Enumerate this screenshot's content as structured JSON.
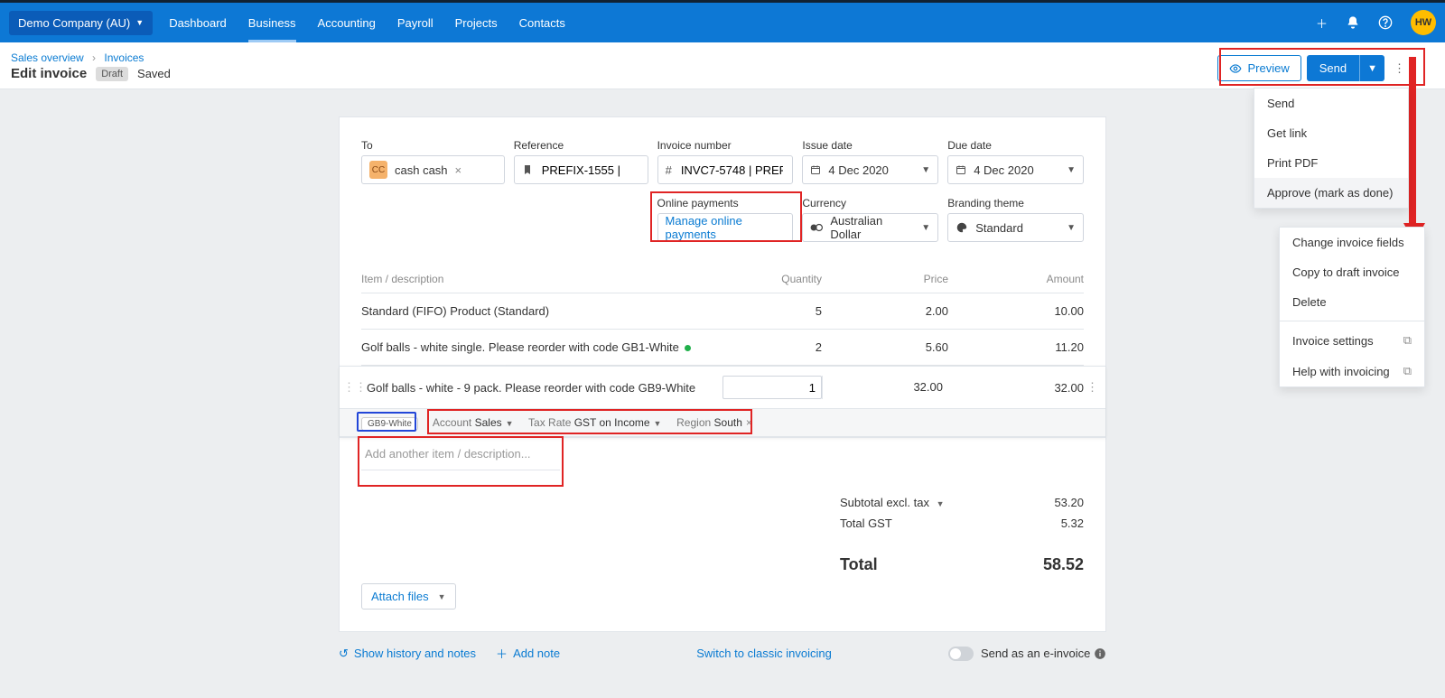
{
  "nav": {
    "org": "Demo Company (AU)",
    "links": [
      "Dashboard",
      "Business",
      "Accounting",
      "Payroll",
      "Projects",
      "Contacts"
    ],
    "active_idx": 1,
    "avatar": "HW"
  },
  "breadcrumb": {
    "a": "Sales overview",
    "b": "Invoices"
  },
  "header": {
    "title": "Edit invoice",
    "status": "Draft",
    "saved": "Saved",
    "preview": "Preview",
    "send": "Send"
  },
  "form": {
    "to_label": "To",
    "to_chip": "CC",
    "to_value": "cash cash",
    "ref_label": "Reference",
    "ref_value": "PREFIX-1555 |",
    "num_label": "Invoice number",
    "num_value": "INVC7-5748 | PREF",
    "issue_label": "Issue date",
    "issue_value": "4 Dec 2020",
    "due_label": "Due date",
    "due_value": "4 Dec 2020",
    "online_label": "Online payments",
    "online_link": "Manage online payments",
    "currency_label": "Currency",
    "currency_value": "Australian Dollar",
    "brand_label": "Branding theme",
    "brand_value": "Standard"
  },
  "columns": {
    "item": "Item / description",
    "qty": "Quantity",
    "price": "Price",
    "amount": "Amount"
  },
  "lines": {
    "row0": {
      "desc": "Standard (FIFO) Product (Standard)",
      "qty": "5",
      "price": "2.00",
      "amount": "10.00"
    },
    "row1": {
      "desc": "Golf balls - white single. Please reorder with code GB1-White",
      "qty": "2",
      "price": "5.60",
      "amount": "11.20"
    },
    "row2": {
      "desc": "Golf balls - white - 9 pack. Please reorder with code GB9-White",
      "qty": "1",
      "price": "32.00",
      "amount": "32.00"
    },
    "code": "GB9-White",
    "meta": {
      "acct_lb": "Account",
      "acct": "Sales",
      "tax_lb": "Tax Rate",
      "tax": "GST on Income",
      "region_lb": "Region",
      "region": "South"
    },
    "add_placeholder": "Add another item / description..."
  },
  "totals": {
    "subtotal_lb": "Subtotal excl. tax",
    "subtotal": "53.20",
    "gst_lb": "Total GST",
    "gst": "5.32",
    "total_lb": "Total",
    "total": "58.52"
  },
  "attach": "Attach files",
  "footer": {
    "history": "Show history and notes",
    "add_note": "Add note",
    "switch": "Switch to classic invoicing",
    "einv": "Send as an e-invoice"
  },
  "menu1": {
    "send": "Send",
    "link": "Get link",
    "pdf": "Print PDF",
    "approve": "Approve (mark as done)"
  },
  "menu2": {
    "change": "Change invoice fields",
    "copy": "Copy to draft invoice",
    "del": "Delete",
    "settings": "Invoice settings",
    "help": "Help with invoicing"
  }
}
